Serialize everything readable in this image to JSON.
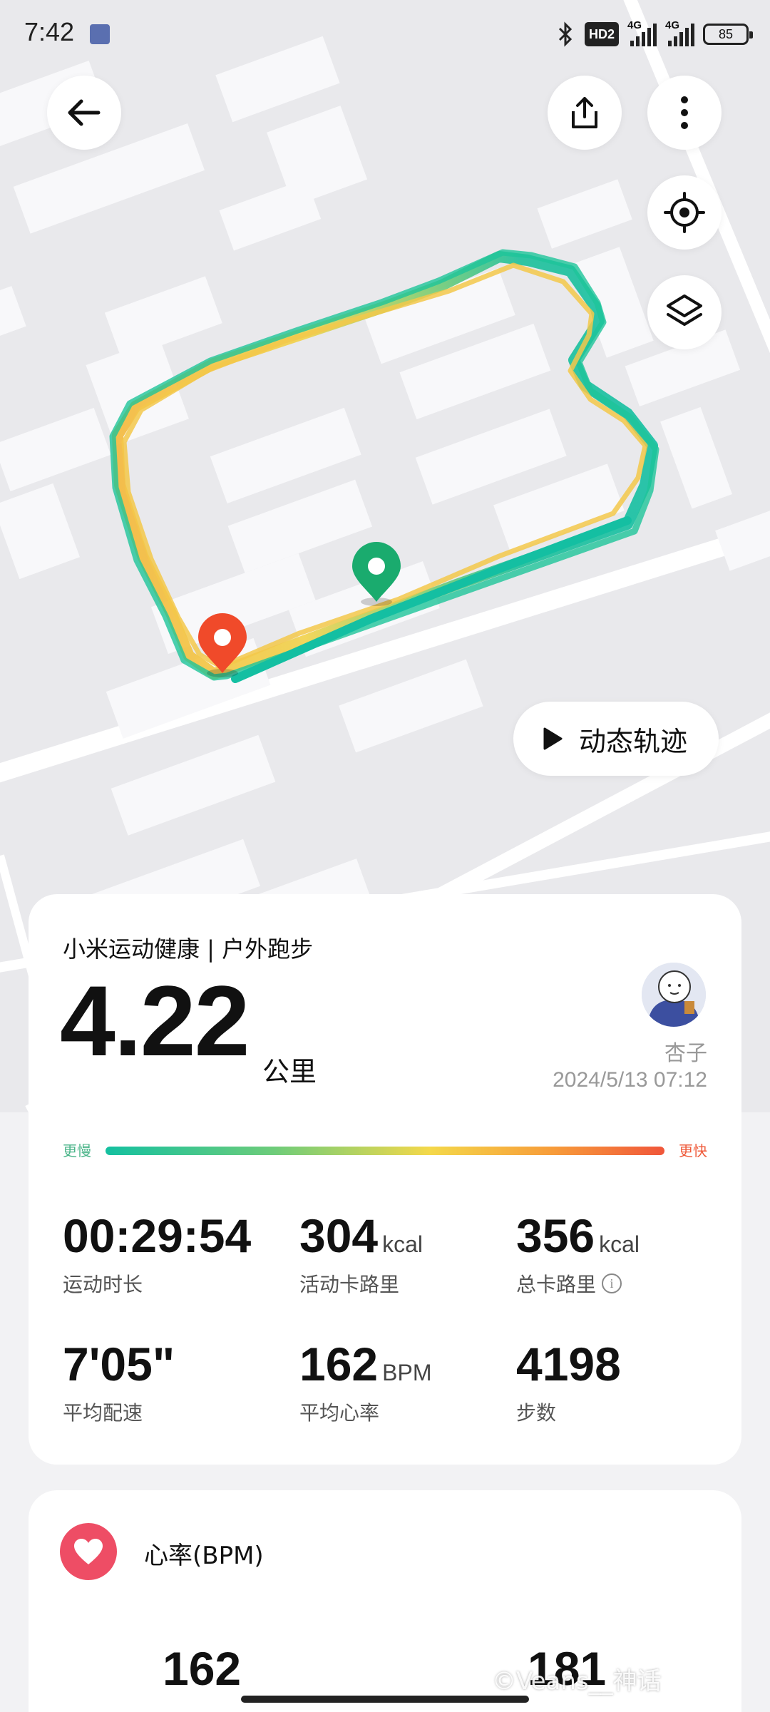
{
  "status_bar": {
    "time": "7:42",
    "hd_label": "HD2",
    "network_1": "4G",
    "network_2": "4G",
    "battery": "85"
  },
  "map": {
    "replay_label": "动态轨迹",
    "colors": {
      "slow": "#14c0a0",
      "fast": "#f0563a",
      "start_pin": "#1aab6e",
      "end_pin": "#f04a2a"
    }
  },
  "summary": {
    "title": "小米运动健康 | 户外跑步",
    "distance": "4.22",
    "distance_unit": "公里",
    "user_name": "杏子",
    "date_time": "2024/5/13 07:12",
    "pace_legend": {
      "slow": "更慢",
      "fast": "更快"
    },
    "stats": [
      {
        "value": "00:29:54",
        "unit": "",
        "label": "运动时长"
      },
      {
        "value": "304",
        "unit": "kcal",
        "label": "活动卡路里"
      },
      {
        "value": "356",
        "unit": "kcal",
        "label": "总卡路里"
      },
      {
        "value": "7'05\"",
        "unit": "",
        "label": "平均配速"
      },
      {
        "value": "162",
        "unit": "BPM",
        "label": "平均心率"
      },
      {
        "value": "4198",
        "unit": "",
        "label": "步数"
      }
    ]
  },
  "heart_rate": {
    "title": "心率(BPM)",
    "avg_value": "162",
    "max_value": "181"
  },
  "watermark": "©Veans__神话"
}
